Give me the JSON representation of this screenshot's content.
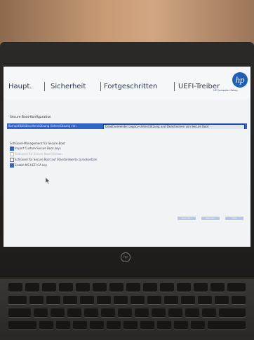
{
  "tabs": [
    {
      "label": "Haupt."
    },
    {
      "label": "Sicherheit"
    },
    {
      "label": "Fortgeschritten"
    },
    {
      "label": "UEFI-Treiber"
    }
  ],
  "brand": {
    "logo_text": "hp",
    "subtitle": "HP Computer Setup"
  },
  "secure_boot": {
    "section_title": "Secure Boot-Konfiguration",
    "dropdown_left": "Kompatibilitätsunterstützung Unterstützung von",
    "dropdown_selected": "Deaktivierender Legacy-Unterstützung und Deaktivieren von Secure Boot"
  },
  "key_management": {
    "title": "Schlüssel-Management für Secure Boot",
    "options": [
      {
        "label": "Import Custom Secure Boot keys",
        "checked": true,
        "disabled": false
      },
      {
        "label": "Schlüssel für Secure Boot löschen",
        "checked": false,
        "disabled": true
      },
      {
        "label": "Schlüssel für Secure Boot auf Standardwerte zurücksetzen",
        "checked": false,
        "disabled": false
      },
      {
        "label": "Enable MS UEFI CA key",
        "checked": true,
        "disabled": false
      }
    ]
  },
  "buttons": [
    {
      "label": "Speichern"
    },
    {
      "label": "Beenden"
    },
    {
      "label": "Hilfe"
    }
  ],
  "colors": {
    "accent": "#2f63c7",
    "screen_bg": "#f1f3f5",
    "tab_text": "#2c3a57"
  }
}
